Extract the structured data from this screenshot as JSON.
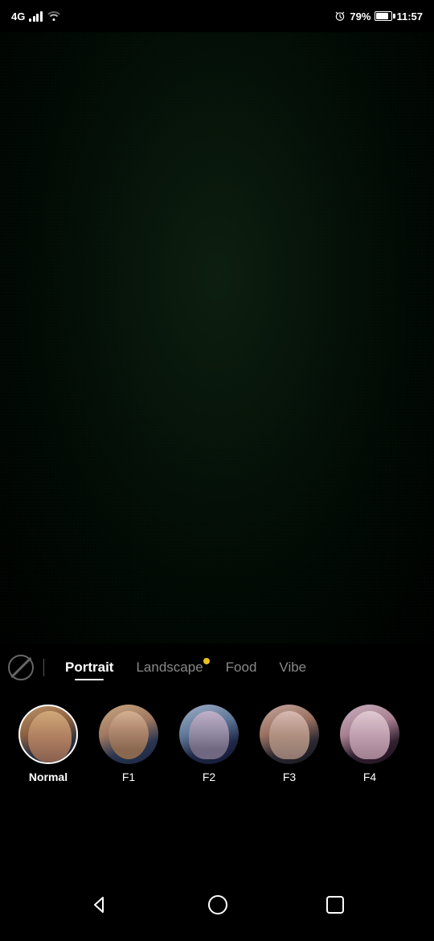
{
  "statusBar": {
    "signal": "4G",
    "battery": "79%",
    "time": "11:57",
    "batteryLevel": 79
  },
  "filterTabs": {
    "items": [
      {
        "id": "portrait",
        "label": "Portrait",
        "active": true,
        "hasDot": false
      },
      {
        "id": "landscape",
        "label": "Landscape",
        "active": false,
        "hasDot": true
      },
      {
        "id": "food",
        "label": "Food",
        "active": false,
        "hasDot": false
      },
      {
        "id": "vibe",
        "label": "Vibe",
        "active": false,
        "hasDot": false
      }
    ]
  },
  "filterPresets": {
    "items": [
      {
        "id": "normal",
        "label": "Normal",
        "selected": true
      },
      {
        "id": "f1",
        "label": "F1",
        "selected": false
      },
      {
        "id": "f2",
        "label": "F2",
        "selected": false
      },
      {
        "id": "f3",
        "label": "F3",
        "selected": false
      },
      {
        "id": "f4",
        "label": "F4",
        "selected": false
      }
    ]
  },
  "bottomNav": {
    "back": "◁",
    "home": "○",
    "recent": "□"
  }
}
